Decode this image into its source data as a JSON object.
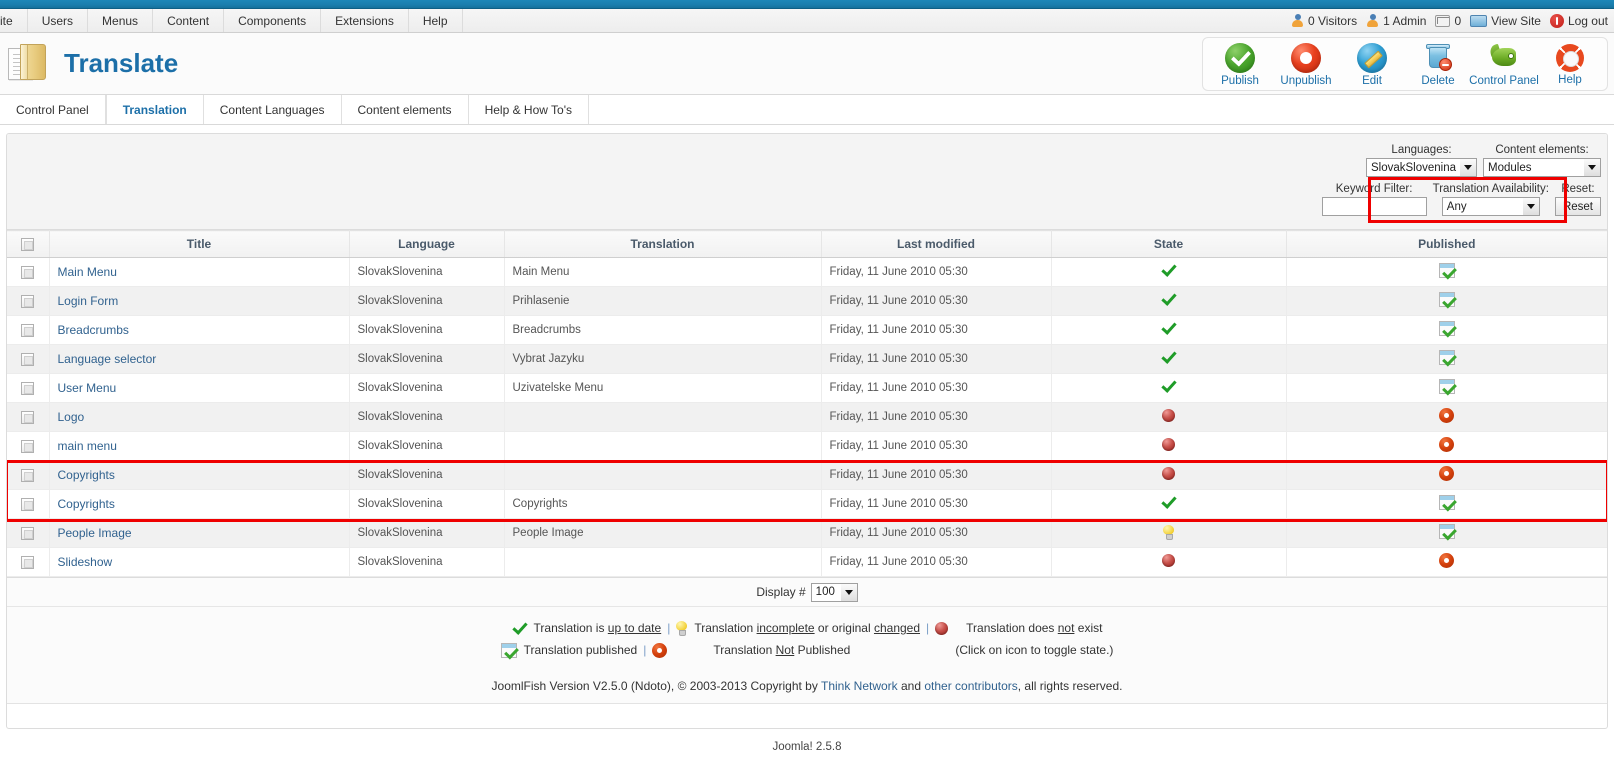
{
  "menubar": {
    "items": [
      "ite",
      "Users",
      "Menus",
      "Content",
      "Components",
      "Extensions",
      "Help"
    ]
  },
  "status": {
    "visitors": "0 Visitors",
    "admins": "1 Admin",
    "messages": "0",
    "view_site": "View Site",
    "logout": "Log out"
  },
  "header": {
    "title": "Translate"
  },
  "toolbar": {
    "buttons": [
      {
        "label": "Publish",
        "icon": "publish-icon"
      },
      {
        "label": "Unpublish",
        "icon": "unpublish-icon"
      },
      {
        "label": "Edit",
        "icon": "edit-icon"
      },
      {
        "label": "Delete",
        "icon": "delete-icon"
      },
      {
        "label": "Control Panel",
        "icon": "control-panel-icon"
      },
      {
        "label": "Help",
        "icon": "help-icon"
      }
    ]
  },
  "tabs": [
    {
      "label": "Control Panel",
      "active": false
    },
    {
      "label": "Translation",
      "active": true
    },
    {
      "label": "Content Languages",
      "active": false
    },
    {
      "label": "Content elements",
      "active": false
    },
    {
      "label": "Help & How To's",
      "active": false
    }
  ],
  "filters": {
    "languages_label": "Languages:",
    "languages_value": "SlovakSlovenina",
    "content_elements_label": "Content elements:",
    "content_elements_value": "Modules",
    "keyword_label": "Keyword Filter:",
    "keyword_value": "",
    "availability_label": "Translation Availability:",
    "availability_value": "Any",
    "reset_label": "Reset:",
    "reset_button": "Reset"
  },
  "table": {
    "columns": [
      "Title",
      "Language",
      "Translation",
      "Last modified",
      "State",
      "Published"
    ],
    "rows": [
      {
        "title": "Main Menu",
        "language": "SlovakSlovenina",
        "translation": "Main Menu",
        "modified": "Friday, 11 June 2010 05:30",
        "state": "check",
        "published": "yes"
      },
      {
        "title": "Login Form",
        "language": "SlovakSlovenina",
        "translation": "Prihlasenie",
        "modified": "Friday, 11 June 2010 05:30",
        "state": "check",
        "published": "yes"
      },
      {
        "title": "Breadcrumbs",
        "language": "SlovakSlovenina",
        "translation": "Breadcrumbs",
        "modified": "Friday, 11 June 2010 05:30",
        "state": "check",
        "published": "yes"
      },
      {
        "title": "Language selector",
        "language": "SlovakSlovenina",
        "translation": "Vybrat Jazyku",
        "modified": "Friday, 11 June 2010 05:30",
        "state": "check",
        "published": "yes"
      },
      {
        "title": "User Menu",
        "language": "SlovakSlovenina",
        "translation": "Uzivatelske Menu",
        "modified": "Friday, 11 June 2010 05:30",
        "state": "check",
        "published": "yes"
      },
      {
        "title": "Logo",
        "language": "SlovakSlovenina",
        "translation": "",
        "modified": "Friday, 11 June 2010 05:30",
        "state": "red",
        "published": "no"
      },
      {
        "title": "main menu",
        "language": "SlovakSlovenina",
        "translation": "",
        "modified": "Friday, 11 June 2010 05:30",
        "state": "red",
        "published": "no"
      },
      {
        "title": "Copyrights",
        "language": "SlovakSlovenina",
        "translation": "",
        "modified": "Friday, 11 June 2010 05:30",
        "state": "red",
        "published": "no"
      },
      {
        "title": "Copyrights",
        "language": "SlovakSlovenina",
        "translation": "Copyrights",
        "modified": "Friday, 11 June 2010 05:30",
        "state": "check",
        "published": "yes"
      },
      {
        "title": "People Image",
        "language": "SlovakSlovenina",
        "translation": "People Image",
        "modified": "Friday, 11 June 2010 05:30",
        "state": "bulb",
        "published": "yes"
      },
      {
        "title": "Slideshow",
        "language": "SlovakSlovenina",
        "translation": "",
        "modified": "Friday, 11 June 2010 05:30",
        "state": "red",
        "published": "no"
      }
    ]
  },
  "display": {
    "label": "Display #",
    "value": "100"
  },
  "legend": {
    "up_to_date_pre": "Translation is ",
    "up_to_date_link": "up to date",
    "incomplete_pre": "Translation ",
    "incomplete_link": "incomplete",
    "incomplete_mid": " or original ",
    "incomplete_link2": "changed",
    "not_exist_pre": "Translation does ",
    "not_exist_link": "not",
    "not_exist_post": " exist",
    "published": "Translation published",
    "not_published_pre": "Translation ",
    "not_published_link": "Not",
    "not_published_post": " Published",
    "hint": "(Click on icon to toggle state.)"
  },
  "footer": {
    "copyright_pre": "JoomlFish Version V2.5.0 (Ndoto), © 2003-2013 Copyright by ",
    "link1": "Think Network",
    "copyright_mid": " and ",
    "link2": "other contributors",
    "copyright_post": ", all rights reserved.",
    "joomla": "Joomla! 2.5.8"
  },
  "colors": {
    "accent": "#1c6fa8",
    "link": "#31628f",
    "highlight": "#ef0000",
    "topbar": "#1a7ead"
  }
}
